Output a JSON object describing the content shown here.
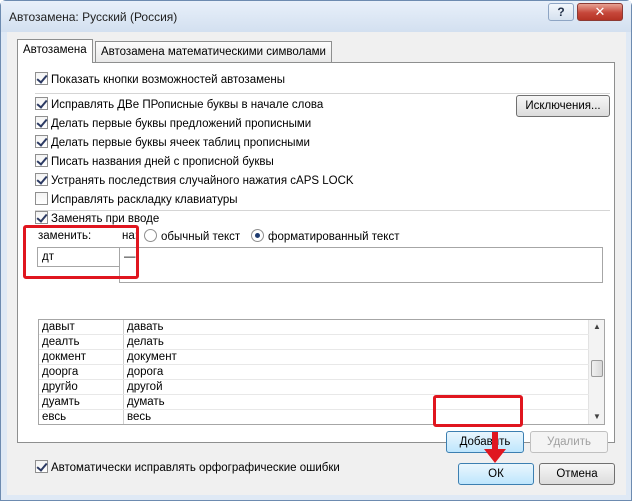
{
  "window": {
    "title": "Автозамена: Русский (Россия)",
    "help_label": "?",
    "close_label": "✕"
  },
  "tabs": [
    {
      "label": "Автозамена",
      "active": true
    },
    {
      "label": "Автозамена математическими символами",
      "active": false
    }
  ],
  "options": {
    "show_buttons": {
      "label": "Показать кнопки возможностей автозамены",
      "checked": true
    },
    "two_initial_caps": {
      "label": "Исправлять ДВе ПРописные буквы в начале слова",
      "checked": true
    },
    "capitalize_sentences": {
      "label": "Делать первые буквы предложений прописными",
      "checked": true
    },
    "capitalize_table_cells": {
      "label": "Делать первые буквы ячеек таблиц прописными",
      "checked": true
    },
    "capitalize_days": {
      "label": "Писать названия дней с прописной буквы",
      "checked": true
    },
    "caps_lock": {
      "label": "Устранять последствия случайного нажатия cAPS LOCK",
      "checked": true
    },
    "keyboard_layout": {
      "label": "Исправлять раскладку клавиатуры",
      "checked": false
    },
    "replace_text": {
      "label": "Заменять при вводе",
      "checked": true
    },
    "auto_spelling": {
      "label": "Автоматически исправлять орфографические ошибки",
      "checked": true
    }
  },
  "exceptions_button": "Исключения...",
  "replace": {
    "replace_label": "заменить:",
    "with_label": "на:",
    "plain_text_label": "обычный текст",
    "formatted_text_label": "форматированный текст",
    "selected_format": "formatted",
    "replace_value": "дт",
    "with_value": "—"
  },
  "entries": [
    {
      "from": "давыт",
      "to": "давать"
    },
    {
      "from": "деалть",
      "to": "делать"
    },
    {
      "from": "докмент",
      "to": "документ"
    },
    {
      "from": "доорга",
      "to": "дорога"
    },
    {
      "from": "другйо",
      "to": "другой"
    },
    {
      "from": "дуамть",
      "to": "думать"
    },
    {
      "from": "евсь",
      "to": "весь"
    }
  ],
  "buttons": {
    "add": "Добавить",
    "delete": "Удалить",
    "ok": "ОК",
    "cancel": "Отмена"
  },
  "colors": {
    "highlight": "#e0161f"
  },
  "icons": {
    "scroll_up": "▲",
    "scroll_down": "▼",
    "arrow_down": "arrow-down-icon"
  }
}
